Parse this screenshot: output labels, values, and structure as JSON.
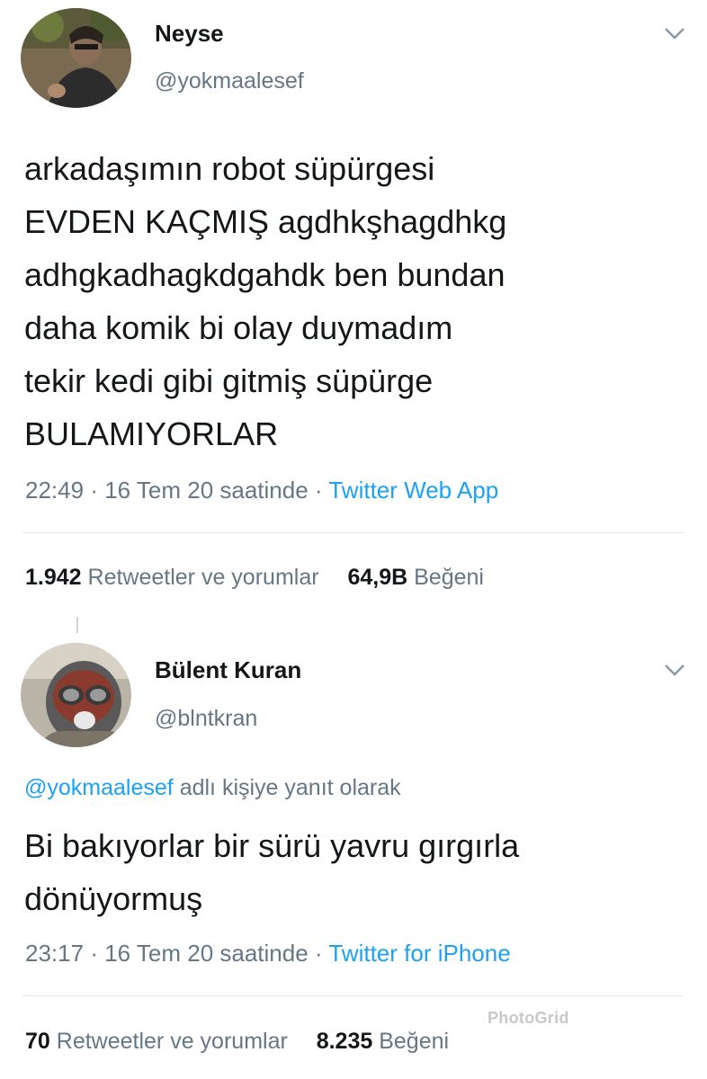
{
  "tweet1": {
    "name": "Neyse",
    "handle": "@yokmaalesef",
    "lines": [
      "arkadaşımın robot süpürgesi",
      "EVDEN KAÇMIŞ agdhkşhagdhkg",
      "adhgkadhagkdgahdk ben bundan",
      "daha komik bi olay duymadım",
      "tekir kedi gibi gitmiş süpürge",
      "BULAMIYORLAR"
    ],
    "time": "22:49",
    "date": "16 Tem 20 saatinde",
    "source": "Twitter Web App",
    "retweets_count": "1.942",
    "retweets_label": "Retweetler ve yorumlar",
    "likes_count": "64,9B",
    "likes_label": "Beğeni"
  },
  "tweet2": {
    "name": "Bülent Kuran",
    "handle": "@blntkran",
    "reply_mention": "@yokmaalesef",
    "reply_text": "adlı kişiye yanıt olarak",
    "lines": [
      "Bi bakıyorlar bir sürü yavru gırgırla",
      "dönüyormuş"
    ],
    "time": "23:17",
    "date": "16 Tem 20 saatinde",
    "source": "Twitter for iPhone",
    "retweets_count": "70",
    "retweets_label": "Retweetler ve yorumlar",
    "likes_count": "8.235",
    "likes_label": "Beğeni"
  },
  "watermark": "PhotoGrid",
  "colors": {
    "text": "#14171a",
    "secondary": "#657786",
    "link": "#1da1f2",
    "divider": "#e1e8ed"
  }
}
